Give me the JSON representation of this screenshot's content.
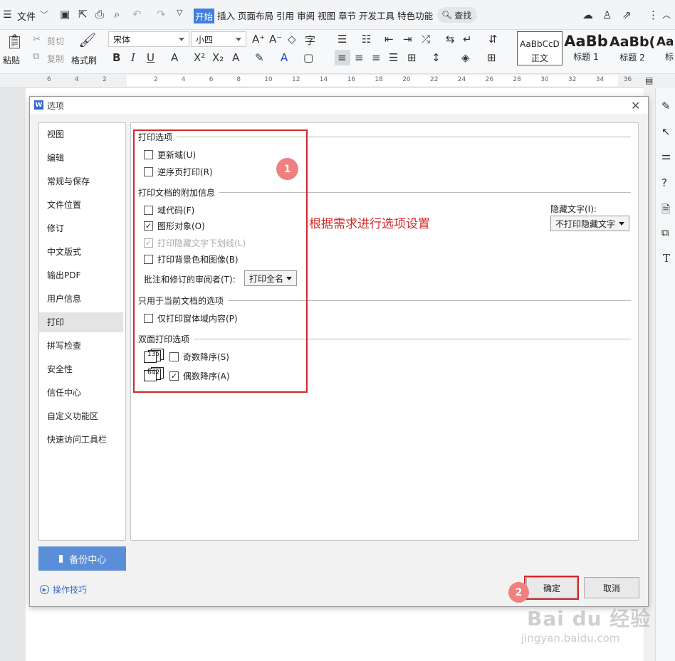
{
  "ribbon": {
    "file_menu": "文件",
    "tabs": [
      "开始",
      "插入",
      "页面布局",
      "引用",
      "审阅",
      "视图",
      "章节",
      "开发工具",
      "特色功能"
    ],
    "active_tab": "开始",
    "search": "查找",
    "paste": "粘贴",
    "cut": "剪切",
    "copy": "复制",
    "format_painter": "格式刷",
    "font_name": "宋体",
    "font_size": "小四",
    "styles": [
      {
        "preview": "AaBbCcD",
        "label": "正文"
      },
      {
        "preview": "AaBb",
        "label": "标题 1"
      },
      {
        "preview": "AaBb(",
        "label": "标题 2"
      },
      {
        "preview": "AaE",
        "label": "标"
      }
    ],
    "ruler_numbers": [
      "6",
      "4",
      "2",
      "2",
      "4",
      "6",
      "8",
      "10",
      "12",
      "14",
      "16",
      "18",
      "20",
      "22",
      "24",
      "26",
      "28",
      "30",
      "32",
      "34",
      "36"
    ]
  },
  "dialog": {
    "title": "选项",
    "nav_items": [
      "视图",
      "编辑",
      "常规与保存",
      "文件位置",
      "修订",
      "中文版式",
      "输出PDF",
      "用户信息",
      "打印",
      "拼写检查",
      "安全性",
      "信任中心",
      "自定义功能区",
      "快速访问工具栏"
    ],
    "selected_nav": "打印",
    "backup_button": "备份中心",
    "tips_link": "操作技巧",
    "sections": {
      "print_options": "打印选项",
      "extra_info": "打印文档的附加信息",
      "current_doc": "只用于当前文档的选项",
      "duplex": "双面打印选项"
    },
    "options": {
      "update_fields": {
        "label": "更新域(U)",
        "checked": false
      },
      "reverse_order": {
        "label": "逆序页打印(R)",
        "checked": false
      },
      "field_codes": {
        "label": "域代码(F)",
        "checked": false
      },
      "drawing_objects": {
        "label": "图形对象(O)",
        "checked": true
      },
      "hidden_underline": {
        "label": "打印隐藏文字下划线(L)",
        "checked": true
      },
      "background": {
        "label": "背景色和图像(B)",
        "checked": false
      },
      "form_data": {
        "label": "仅打印窗体域内容(P)",
        "checked": false
      },
      "odd_reverse": {
        "label": "奇数降序(S)",
        "checked": false
      },
      "even_reverse": {
        "label": "偶数降序(A)",
        "checked": true
      }
    },
    "labels": {
      "print_bg_prefix": "打印",
      "reviewer_label": "批注和修订的审阅者(T):",
      "reviewer_value": "打印全名",
      "hidden_text_label": "隐藏文字(I):",
      "hidden_text_value": "不打印隐藏文字"
    },
    "duplex_icons": {
      "odd": "135",
      "even": "642"
    },
    "ok": "确定",
    "cancel": "取消"
  },
  "annotations": {
    "note": "根据需求进行选项设置",
    "marker1": "1",
    "marker2": "2",
    "color": "#d42828"
  },
  "watermark": {
    "brand": "Bai du 经验",
    "url": "jingyan.baidu.com"
  }
}
